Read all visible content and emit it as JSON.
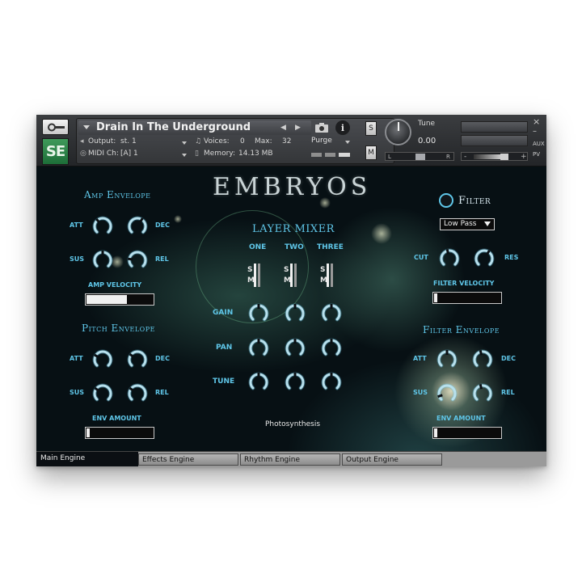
{
  "header": {
    "instrument_title": "Drain In The Underground",
    "output_label": "Output:",
    "output_value": "st. 1",
    "midi_label": "MIDI Ch:",
    "midi_value": "[A]  1",
    "voices_label": "Voices:",
    "voices_value": "0",
    "max_label": "Max:",
    "max_value": "32",
    "memory_label": "Memory:",
    "memory_value": "14.13 MB",
    "purge_label": "Purge",
    "info_glyph": "i",
    "logo_text": "SE",
    "solo_label": "S",
    "mute_label": "M",
    "tune_label": "Tune",
    "tune_value": "0.00",
    "pan_left": "L",
    "pan_right": "R",
    "vol_minus": "-",
    "vol_plus": "+",
    "close_glyph": "×",
    "minimize_glyph": "–",
    "aux_label": "AUX",
    "pv_label": "PV"
  },
  "brand": "EMBRYOS",
  "amp_envelope": {
    "title": "Amp Envelope",
    "att": "ATT",
    "dec": "DEC",
    "sus": "SUS",
    "rel": "REL",
    "velocity_label": "AMP VELOCITY",
    "velocity_value": 0.62
  },
  "pitch_envelope": {
    "title": "Pitch Envelope",
    "att": "ATT",
    "dec": "DEC",
    "sus": "SUS",
    "rel": "REL",
    "amount_label": "ENV AMOUNT",
    "amount_value": 0.05
  },
  "layer_mixer": {
    "title": "LAYER MIXER",
    "layers": [
      "ONE",
      "TWO",
      "THREE"
    ],
    "solo": "S",
    "mute": "M",
    "rows": [
      "GAIN",
      "PAN",
      "TUNE"
    ]
  },
  "filter": {
    "label": "Filter",
    "type_value": "Low Pass",
    "cut": "CUT",
    "res": "RES",
    "velocity_label": "FILTER VELOCITY",
    "velocity_value": 0.05
  },
  "filter_envelope": {
    "title": "Filter Envelope",
    "att": "ATT",
    "dec": "DEC",
    "sus": "SUS",
    "rel": "REL",
    "amount_label": "ENV AMOUNT",
    "amount_value": 0.05
  },
  "snapshot_name": "Photosynthesis",
  "tabs": [
    "Main Engine",
    "Effects Engine",
    "Rhythm Engine",
    "Output Engine"
  ],
  "colors": {
    "accent": "#5fc6e8",
    "panel_bg": "#0b0f13"
  }
}
